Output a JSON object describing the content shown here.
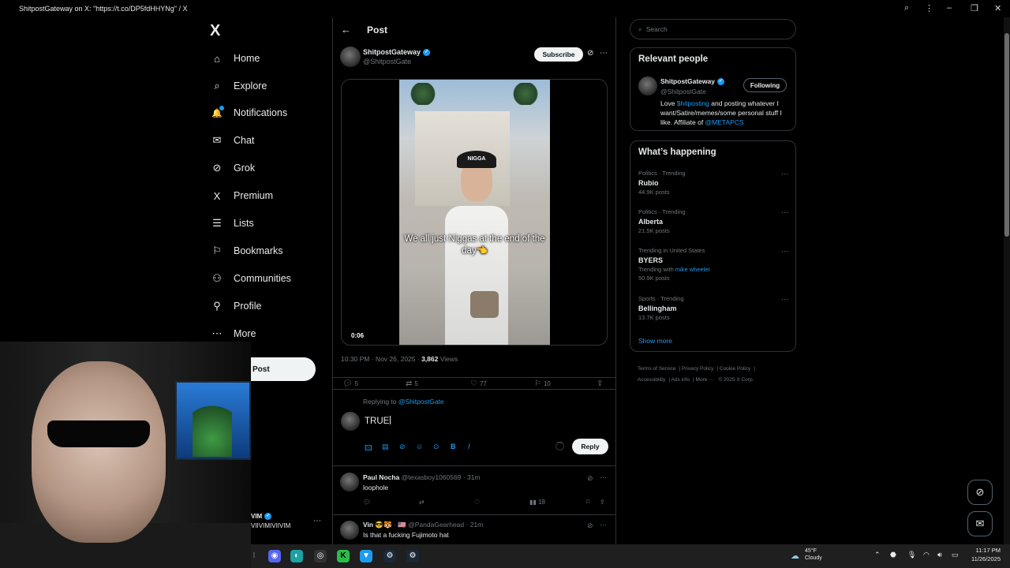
{
  "window": {
    "title": "ShitpostGateway on X: \"https://t.co/DP5fdHHYNg\" / X"
  },
  "nav": {
    "logo": "X",
    "items": [
      {
        "label": "Home",
        "icon": "⌂"
      },
      {
        "label": "Explore",
        "icon": "⌕"
      },
      {
        "label": "Notifications",
        "icon": "🔔"
      },
      {
        "label": "Chat",
        "icon": "✉"
      },
      {
        "label": "Grok",
        "icon": "⊘"
      },
      {
        "label": "Premium",
        "icon": "X"
      },
      {
        "label": "Lists",
        "icon": "☰"
      },
      {
        "label": "Bookmarks",
        "icon": "⚐"
      },
      {
        "label": "Communities",
        "icon": "⚇"
      },
      {
        "label": "Profile",
        "icon": "⚲"
      },
      {
        "label": "More",
        "icon": "⋯"
      }
    ],
    "post_button": "Post",
    "account": {
      "name": "VIM",
      "handle": "VIIVIMIVIIVIM"
    }
  },
  "main": {
    "title": "Post",
    "author": {
      "name": "ShitpostGateway",
      "handle": "@ShitpostGate"
    },
    "subscribe_label": "Subscribe",
    "video": {
      "cap_text": "NIGGA",
      "caption": "We all just Niggas at the end of the day👈",
      "duration": "0:06"
    },
    "meta": {
      "time": "10:30 PM · Nov 26, 2025 · ",
      "views_count": "3,862",
      "views_label": " Views"
    },
    "actions": {
      "replies": "5",
      "reposts": "5",
      "likes": "77",
      "bookmarks": "10"
    },
    "reply_box": {
      "replying_prefix": "Replying to ",
      "replying_handle": "@ShitpostGate",
      "draft_text": "TRUE",
      "reply_button": "Reply"
    },
    "replies": [
      {
        "name": "Paul Nocha",
        "meta": "@texasboy1060569 · 31m",
        "text": "loophole",
        "views": "18"
      },
      {
        "name": "Vin 😎🐯",
        "meta": "· 🇺🇸 @PandaGearhead · 21m",
        "text": "Is that a fucking Fujimoto hat"
      }
    ]
  },
  "sidebar": {
    "search_placeholder": "Search",
    "relevant_people": {
      "title": "Relevant people",
      "name": "ShitpostGateway",
      "handle": "@ShitpostGate",
      "follow_label": "Following",
      "bio_1": "Love ",
      "bio_link": "$hitposting",
      "bio_2": " and posting whatever I want/Satire/memes/some personal stuff I like. Affiliate of ",
      "bio_link_2": "@METAPCS"
    },
    "happening": {
      "title": "What’s happening",
      "trends": [
        {
          "meta": "Politics · Trending",
          "name": "Rubio",
          "sub": "44.9K posts"
        },
        {
          "meta": "Politics · Trending",
          "name": "Alberta",
          "sub": "21.5K posts"
        },
        {
          "meta": "Trending in United States",
          "name": "BYERS",
          "sub_prefix": "Trending with ",
          "sub_link": "mike wheeler",
          "sub": "50.9K posts"
        },
        {
          "meta": "Sports · Trending",
          "name": "Bellingham",
          "sub": "13.7K posts"
        }
      ],
      "show_more": "Show more"
    },
    "footer": [
      "Terms of Service",
      "Privacy Policy",
      "Cookie Policy",
      "Accessibility",
      "Ads info",
      "More ···",
      "© 2025 X Corp."
    ]
  },
  "taskbar": {
    "weather_temp": "45°F",
    "weather_desc": "Cloudy",
    "time": "11:17 PM",
    "date": "11/26/2025"
  },
  "colors": {
    "accent": "#1d9bf0",
    "background": "#000000",
    "border": "#2f3336",
    "muted": "#71767b"
  }
}
